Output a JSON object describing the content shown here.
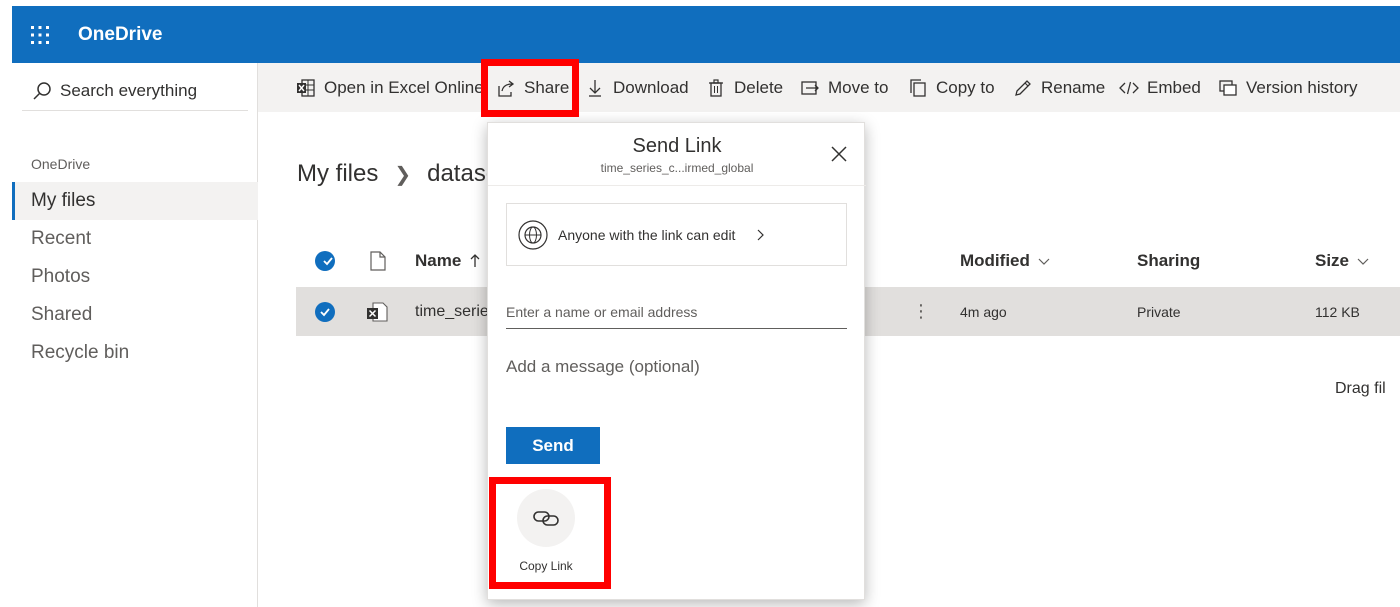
{
  "app": {
    "brand": "OneDrive"
  },
  "search": {
    "placeholder": "Search everything"
  },
  "sidebar": {
    "heading": "OneDrive",
    "items": [
      {
        "label": "My files",
        "active": true
      },
      {
        "label": "Recent",
        "active": false
      },
      {
        "label": "Photos",
        "active": false
      },
      {
        "label": "Shared",
        "active": false
      },
      {
        "label": "Recycle bin",
        "active": false
      }
    ]
  },
  "toolbar": {
    "open_excel": "Open in Excel Online",
    "share": "Share",
    "download": "Download",
    "delete": "Delete",
    "move_to": "Move to",
    "copy_to": "Copy to",
    "rename": "Rename",
    "embed": "Embed",
    "version_history": "Version history"
  },
  "breadcrumb": {
    "root": "My files",
    "current": "dataso"
  },
  "columns": {
    "name": "Name",
    "modified": "Modified",
    "sharing": "Sharing",
    "size": "Size"
  },
  "file": {
    "name": "time_serie",
    "modified": "4m ago",
    "sharing": "Private",
    "size": "112 KB"
  },
  "drag_hint": "Drag fil",
  "dialog": {
    "title": "Send Link",
    "subtitle": "time_series_c...irmed_global",
    "permission": "Anyone with the link can edit",
    "email_placeholder": "Enter a name or email address",
    "message_placeholder": "Add a message (optional)",
    "send_label": "Send",
    "copy_link_label": "Copy Link"
  },
  "colors": {
    "accent": "#106ebe",
    "highlight": "#ff0000",
    "selected_row": "#e1dfdd",
    "cmdbar": "#f3f2f1"
  }
}
